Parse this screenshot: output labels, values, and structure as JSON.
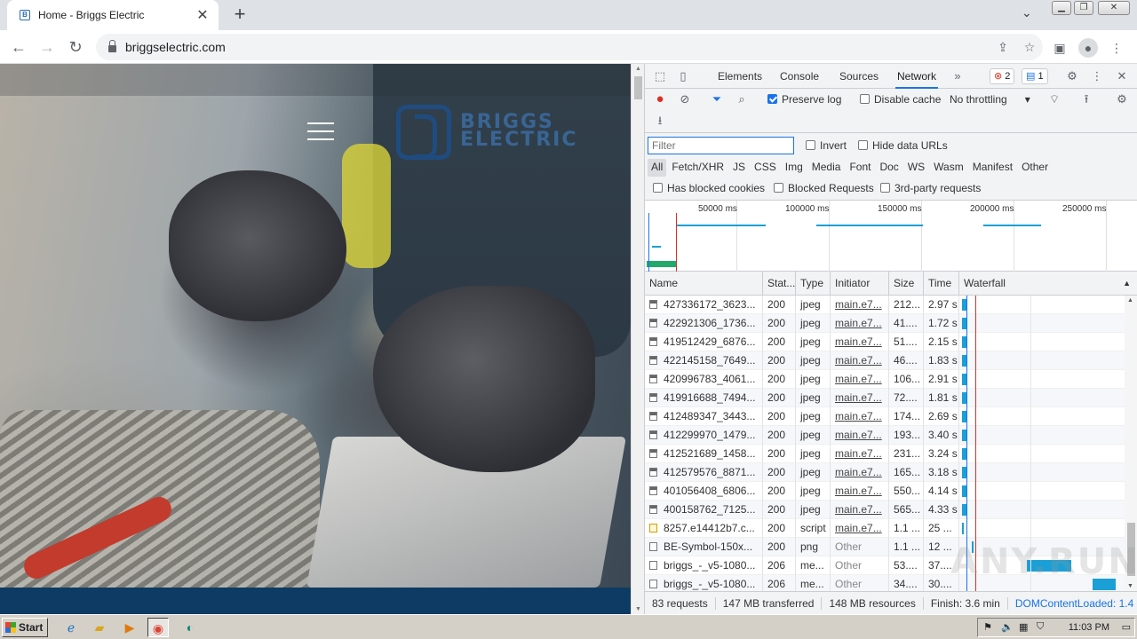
{
  "browser": {
    "tab_title": "Home - Briggs Electric",
    "url": "briggselectric.com"
  },
  "website": {
    "logo_line1": "BRIGGS",
    "logo_line2": "ELECTRIC"
  },
  "devtools": {
    "tabs": [
      "Elements",
      "Console",
      "Sources",
      "Network"
    ],
    "active_tab": "Network",
    "error_count": "2",
    "message_count": "1",
    "preserve_log_label": "Preserve log",
    "preserve_log_checked": true,
    "disable_cache_label": "Disable cache",
    "throttling": "No throttling",
    "filter_placeholder": "Filter",
    "invert_label": "Invert",
    "hide_data_urls_label": "Hide data URLs",
    "type_filters": [
      "All",
      "Fetch/XHR",
      "JS",
      "CSS",
      "Img",
      "Media",
      "Font",
      "Doc",
      "WS",
      "Wasm",
      "Manifest",
      "Other"
    ],
    "has_blocked_cookies_label": "Has blocked cookies",
    "blocked_requests_label": "Blocked Requests",
    "third_party_label": "3rd-party requests",
    "overview_ticks": [
      "50000 ms",
      "100000 ms",
      "150000 ms",
      "200000 ms",
      "250000 ms"
    ],
    "columns": [
      "Name",
      "Stat...",
      "Type",
      "Initiator",
      "Size",
      "Time",
      "Waterfall"
    ],
    "rows": [
      {
        "name": "427336172_3623...",
        "status": "200",
        "type": "jpeg",
        "initiator": "main.e7...",
        "size": "212...",
        "time": "2.97 s",
        "icon": "img"
      },
      {
        "name": "422921306_1736...",
        "status": "200",
        "type": "jpeg",
        "initiator": "main.e7...",
        "size": "41....",
        "time": "1.72 s",
        "icon": "img"
      },
      {
        "name": "419512429_6876...",
        "status": "200",
        "type": "jpeg",
        "initiator": "main.e7...",
        "size": "51....",
        "time": "2.15 s",
        "icon": "img"
      },
      {
        "name": "422145158_7649...",
        "status": "200",
        "type": "jpeg",
        "initiator": "main.e7...",
        "size": "46....",
        "time": "1.83 s",
        "icon": "img"
      },
      {
        "name": "420996783_4061...",
        "status": "200",
        "type": "jpeg",
        "initiator": "main.e7...",
        "size": "106...",
        "time": "2.91 s",
        "icon": "img"
      },
      {
        "name": "419916688_7494...",
        "status": "200",
        "type": "jpeg",
        "initiator": "main.e7...",
        "size": "72....",
        "time": "1.81 s",
        "icon": "img"
      },
      {
        "name": "412489347_3443...",
        "status": "200",
        "type": "jpeg",
        "initiator": "main.e7...",
        "size": "174...",
        "time": "2.69 s",
        "icon": "img"
      },
      {
        "name": "412299970_1479...",
        "status": "200",
        "type": "jpeg",
        "initiator": "main.e7...",
        "size": "193...",
        "time": "3.40 s",
        "icon": "img"
      },
      {
        "name": "412521689_1458...",
        "status": "200",
        "type": "jpeg",
        "initiator": "main.e7...",
        "size": "231...",
        "time": "3.24 s",
        "icon": "img"
      },
      {
        "name": "412579576_8871...",
        "status": "200",
        "type": "jpeg",
        "initiator": "main.e7...",
        "size": "165...",
        "time": "3.18 s",
        "icon": "img"
      },
      {
        "name": "401056408_6806...",
        "status": "200",
        "type": "jpeg",
        "initiator": "main.e7...",
        "size": "550...",
        "time": "4.14 s",
        "icon": "img"
      },
      {
        "name": "400158762_7125...",
        "status": "200",
        "type": "jpeg",
        "initiator": "main.e7...",
        "size": "565...",
        "time": "4.33 s",
        "icon": "img"
      },
      {
        "name": "8257.e14412b7.c...",
        "status": "200",
        "type": "script",
        "initiator": "main.e7...",
        "size": "1.1 ...",
        "time": "25 ...",
        "icon": "script"
      },
      {
        "name": "BE-Symbol-150x...",
        "status": "200",
        "type": "png",
        "initiator": "Other",
        "size": "1.1 ...",
        "time": "12 ...",
        "icon": "doc"
      },
      {
        "name": "briggs_-_v5-1080...",
        "status": "206",
        "type": "me...",
        "initiator": "Other",
        "size": "53....",
        "time": "37....",
        "icon": "doc"
      },
      {
        "name": "briggs_-_v5-1080...",
        "status": "206",
        "type": "me...",
        "initiator": "Other",
        "size": "34....",
        "time": "30....",
        "icon": "doc"
      }
    ],
    "status": {
      "requests": "83 requests",
      "transferred": "147 MB transferred",
      "resources": "148 MB resources",
      "finish": "Finish: 3.6 min",
      "dcl": "DOMContentLoaded: 1.4"
    }
  },
  "taskbar": {
    "start_label": "Start",
    "clock": "11:03 PM"
  },
  "watermark": "ANY.RUN"
}
